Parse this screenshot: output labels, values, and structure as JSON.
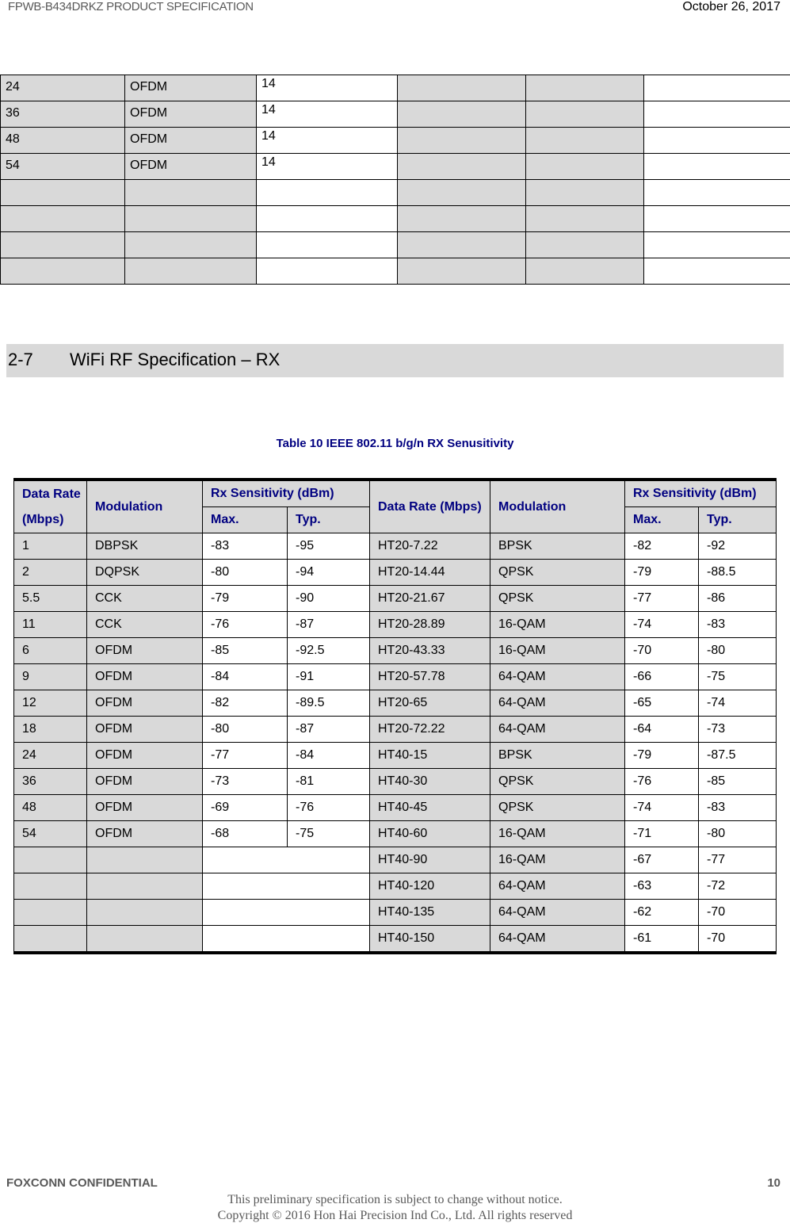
{
  "header": {
    "doc_title": "FPWB-B434DRKZ PRODUCT SPECIFICATION",
    "date": "October 26, 2017"
  },
  "tx_table_continued": {
    "rows": [
      [
        "24",
        "OFDM",
        "14",
        "",
        "",
        ""
      ],
      [
        "36",
        "OFDM",
        "14",
        "",
        "",
        ""
      ],
      [
        "48",
        "OFDM",
        "14",
        "",
        "",
        ""
      ],
      [
        "54",
        "OFDM",
        "14",
        "",
        "",
        ""
      ],
      [
        "",
        "",
        "",
        "",
        "",
        ""
      ],
      [
        "",
        "",
        "",
        "",
        "",
        ""
      ],
      [
        "",
        "",
        "",
        "",
        "",
        ""
      ],
      [
        "",
        "",
        "",
        "",
        "",
        ""
      ]
    ]
  },
  "section": {
    "number": "2-7",
    "title": "WiFi RF Specification – RX"
  },
  "rx_table": {
    "caption": "Table 10 IEEE 802.11 b/g/n RX Senusitivity",
    "headers": {
      "data_rate_left": "Data Rate (Mbps)",
      "modulation_left": "Modulation",
      "rx_sens_left": "Rx Sensitivity (dBm)",
      "data_rate_right": "Data Rate (Mbps)",
      "modulation_right": "Modulation",
      "rx_sens_right": "Rx Sensitivity (dBm)",
      "max": "Max.",
      "typ": "Typ."
    },
    "rows": [
      {
        "rate": "1",
        "mod": "DBPSK",
        "max": "-83",
        "typ": "-95",
        "rate2": "HT20-7.22",
        "mod2": "BPSK",
        "max2": "-82",
        "typ2": "-92"
      },
      {
        "rate": "2",
        "mod": "DQPSK",
        "max": "-80",
        "typ": "-94",
        "rate2": "HT20-14.44",
        "mod2": "QPSK",
        "max2": "-79",
        "typ2": "-88.5"
      },
      {
        "rate": "5.5",
        "mod": "CCK",
        "max": "-79",
        "typ": "-90",
        "rate2": "HT20-21.67",
        "mod2": "QPSK",
        "max2": "-77",
        "typ2": "-86"
      },
      {
        "rate": "11",
        "mod": "CCK",
        "max": "-76",
        "typ": "-87",
        "rate2": "HT20-28.89",
        "mod2": "16-QAM",
        "max2": "-74",
        "typ2": "-83"
      },
      {
        "rate": "6",
        "mod": "OFDM",
        "max": "-85",
        "typ": "-92.5",
        "rate2": "HT20-43.33",
        "mod2": "16-QAM",
        "max2": "-70",
        "typ2": "-80"
      },
      {
        "rate": "9",
        "mod": "OFDM",
        "max": "-84",
        "typ": "-91",
        "rate2": "HT20-57.78",
        "mod2": "64-QAM",
        "max2": "-66",
        "typ2": "-75"
      },
      {
        "rate": "12",
        "mod": "OFDM",
        "max": "-82",
        "typ": "-89.5",
        "rate2": "HT20-65",
        "mod2": "64-QAM",
        "max2": "-65",
        "typ2": "-74"
      },
      {
        "rate": "18",
        "mod": "OFDM",
        "max": "-80",
        "typ": "-87",
        "rate2": "HT20-72.22",
        "mod2": "64-QAM",
        "max2": "-64",
        "typ2": "-73"
      },
      {
        "rate": "24",
        "mod": "OFDM",
        "max": "-77",
        "typ": "-84",
        "rate2": "HT40-15",
        "mod2": "BPSK",
        "max2": "-79",
        "typ2": "-87.5"
      },
      {
        "rate": "36",
        "mod": "OFDM",
        "max": "-73",
        "typ": "-81",
        "rate2": "HT40-30",
        "mod2": "QPSK",
        "max2": "-76",
        "typ2": "-85"
      },
      {
        "rate": "48",
        "mod": "OFDM",
        "max": "-69",
        "typ": "-76",
        "rate2": "HT40-45",
        "mod2": "QPSK",
        "max2": "-74",
        "typ2": "-83"
      },
      {
        "rate": "54",
        "mod": "OFDM",
        "max": "-68",
        "typ": "-75",
        "rate2": "HT40-60",
        "mod2": "16-QAM",
        "max2": "-71",
        "typ2": "-80"
      },
      {
        "rate": "",
        "mod": "",
        "merged": true,
        "rate2": "HT40-90",
        "mod2": "16-QAM",
        "max2": "-67",
        "typ2": "-77"
      },
      {
        "rate": "",
        "mod": "",
        "merged": true,
        "rate2": "HT40-120",
        "mod2": "64-QAM",
        "max2": "-63",
        "typ2": "-72"
      },
      {
        "rate": "",
        "mod": "",
        "merged": true,
        "rate2": "HT40-135",
        "mod2": "64-QAM",
        "max2": "-62",
        "typ2": "-70"
      },
      {
        "rate": "",
        "mod": "",
        "merged": true,
        "rate2": "HT40-150",
        "mod2": "64-QAM",
        "max2": "-61",
        "typ2": "-70"
      }
    ]
  },
  "footer": {
    "confidential": "FOXCONN CONFIDENTIAL",
    "page_number": "10",
    "notice": "This preliminary specification is subject to change without notice.",
    "copyright": "Copyright © 2016 Hon Hai Precision Ind Co., Ltd. All rights reserved"
  }
}
